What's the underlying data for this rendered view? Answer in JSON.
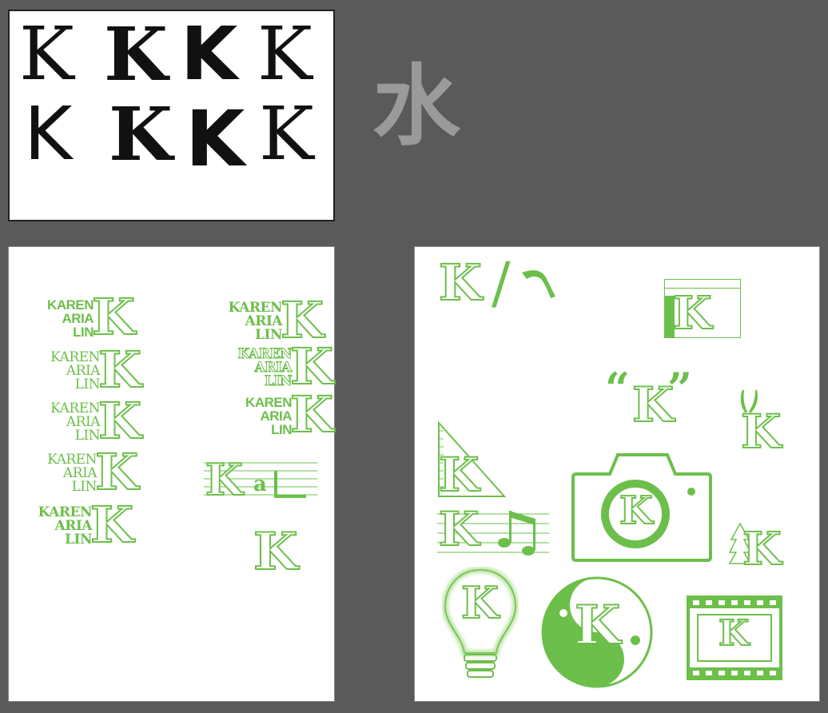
{
  "board_k": {
    "letters": [
      "K",
      "K",
      "K",
      "K",
      "K",
      "K",
      "K",
      "K"
    ]
  },
  "kanji": "水",
  "logos": {
    "name_lines": [
      "KAREN",
      "ARIA",
      "LIN"
    ],
    "k": "K",
    "staff_letters": [
      "K",
      "a"
    ]
  },
  "icons": {
    "k": "K",
    "slash": "/",
    "quote_open": "“",
    "quote_close": "”"
  },
  "colors": {
    "green": "#6dbf4b",
    "canvas": "#5a5a5a",
    "board": "#ffffff"
  }
}
